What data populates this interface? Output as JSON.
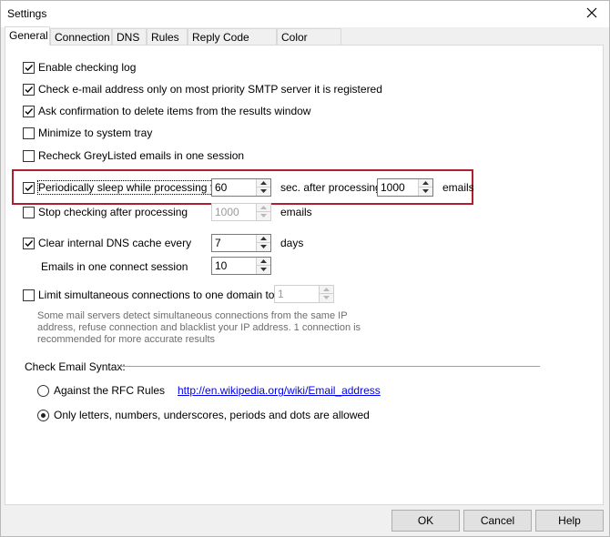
{
  "window": {
    "title": "Settings"
  },
  "tabs": [
    {
      "label": "General"
    },
    {
      "label": "Connection"
    },
    {
      "label": "DNS"
    },
    {
      "label": "Rules"
    },
    {
      "label": "Reply Code Rules"
    },
    {
      "label": "Color Theme"
    }
  ],
  "options": {
    "enable_log": {
      "label": "Enable checking log",
      "checked": true
    },
    "check_most_priority": {
      "label": "Check e-mail address only on most priority SMTP server it is registered",
      "checked": true
    },
    "ask_confirmation": {
      "label": "Ask confirmation to delete items from the results window",
      "checked": true
    },
    "minimize_tray": {
      "label": "Minimize to system tray",
      "checked": false
    },
    "recheck_greylisted": {
      "label": "Recheck GreyListed emails in one session",
      "checked": false
    },
    "periodic_sleep": {
      "label": "Periodically sleep while processing for",
      "checked": true,
      "seconds": "60",
      "after_label": "sec. after processing",
      "emails": "1000",
      "emails_label": "emails"
    },
    "stop_after": {
      "label": "Stop checking after processing",
      "checked": false,
      "value": "1000",
      "unit": "emails"
    },
    "clear_dns": {
      "label": "Clear internal DNS cache every",
      "checked": true,
      "value": "7",
      "unit": "days"
    },
    "emails_per_session": {
      "label": "Emails in one connect session",
      "value": "10"
    },
    "limit_connections": {
      "label": "Limit simultaneous connections to one domain to",
      "checked": false,
      "value": "1"
    },
    "limit_description": "Some mail servers detect simultaneous connections from the same IP address, refuse connection and blacklist your IP address. 1 connection is recommended for more accurate results"
  },
  "syntax": {
    "heading": "Check Email Syntax:",
    "rfc_label": "Against the RFC Rules",
    "rfc_link": "http://en.wikipedia.org/wiki/Email_address",
    "simple_label": "Only letters, numbers, underscores, periods and dots are allowed",
    "selected": "simple"
  },
  "buttons": {
    "ok": "OK",
    "cancel": "Cancel",
    "help": "Help"
  },
  "colors": {
    "highlight": "#b01e2f",
    "link": "#0000ee"
  }
}
